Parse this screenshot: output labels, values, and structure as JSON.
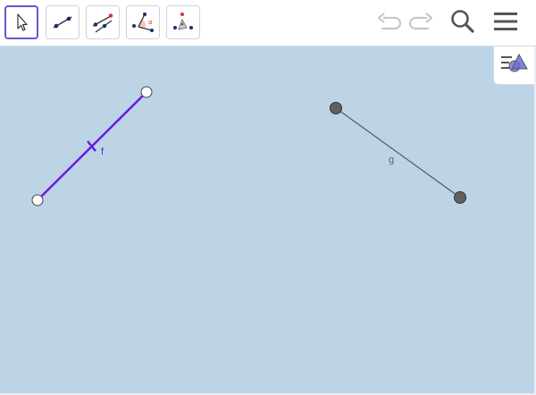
{
  "toolbar": {
    "tools": [
      {
        "icon": "move-arrow-icon",
        "selected": true
      },
      {
        "icon": "line-icon",
        "selected": false
      },
      {
        "icon": "perpendicular-line-icon",
        "selected": false
      },
      {
        "icon": "angle-icon",
        "selected": false
      },
      {
        "icon": "reflect-icon",
        "selected": false
      }
    ],
    "undo_icon": "undo-icon",
    "redo_icon": "redo-icon",
    "search_icon": "search-icon",
    "menu_icon": "hamburger-menu-icon"
  },
  "graphics": {
    "background_color": "#bdd4e7",
    "segment_f": {
      "label": "f",
      "color": "#6a1be0"
    },
    "segment_g": {
      "label": "g",
      "color": "#616161"
    }
  },
  "style_bar_icon": "style-bar-toggle-icon"
}
